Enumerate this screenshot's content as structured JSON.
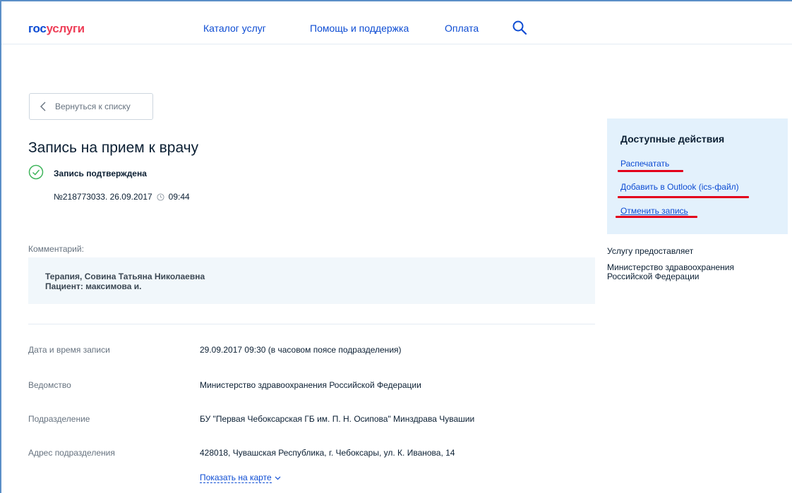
{
  "header": {
    "logo_part1": "гос",
    "logo_part2": "услуги",
    "nav": [
      "Каталог услуг",
      "Помощь и поддержка",
      "Оплата"
    ]
  },
  "back_button": {
    "label": "Вернуться к списку"
  },
  "title": "Запись на прием к врачу",
  "status": {
    "text": "Запись подтверждена"
  },
  "record": {
    "number": "№218773033. 26.09.2017",
    "time": "09:44"
  },
  "comment": {
    "label": "Комментарий:",
    "line1": "Терапия, Совина Татьяна Николаевна",
    "line2": "Пациент: максимова и."
  },
  "details": [
    {
      "label": "Дата и время записи",
      "value": "29.09.2017 09:30 (в часовом поясе подразделения)"
    },
    {
      "label": "Ведомство",
      "value": "Министерство здравоохранения Российской Федерации"
    },
    {
      "label": "Подразделение",
      "value": "БУ \"Первая Чебоксарская ГБ им. П. Н. Осипова\" Минздрава Чувашии"
    },
    {
      "label": "Адрес подразделения",
      "value": "428018, Чувашская Республика, г. Чебоксары, ул. К. Иванова, 14"
    }
  ],
  "map_link": "Показать на карте",
  "actions": {
    "title": "Доступные действия",
    "items": [
      "Распечатать",
      "Добавить в Outlook (ics-файл)",
      "Отменить запись"
    ]
  },
  "provider": {
    "label": "Услугу предоставляет",
    "name": "Министерство здравоохранения Российской Федерации"
  },
  "colors": {
    "accent": "#0d4cd3",
    "logo_red": "#ee3f58",
    "success": "#3fb55b",
    "highlight": "#e3001b",
    "panel": "#e3f1fc"
  }
}
